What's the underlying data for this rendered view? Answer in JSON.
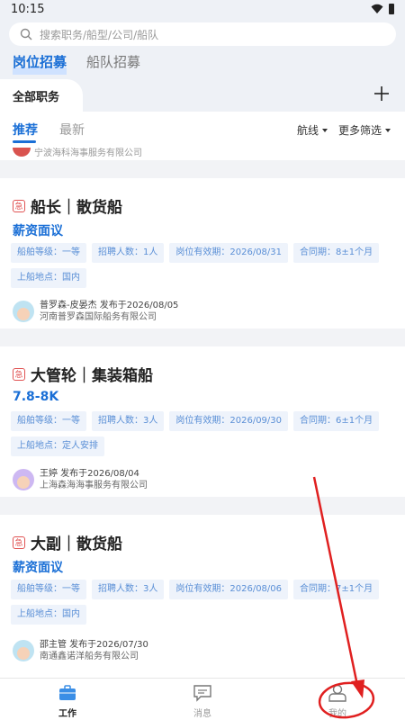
{
  "status_bar": {
    "time": "10:15"
  },
  "search": {
    "placeholder": "搜索职务/船型/公司/船队"
  },
  "top_tabs": [
    {
      "label": "岗位招募"
    },
    {
      "label": "船队招募"
    }
  ],
  "category": {
    "label": "全部职务"
  },
  "sub_tabs": [
    {
      "label": "推荐"
    },
    {
      "label": "最新"
    }
  ],
  "filters": [
    {
      "label": "航线"
    },
    {
      "label": "更多筛选"
    }
  ],
  "partial_card": {
    "company": "宁波海科海事服务有限公司"
  },
  "urgent_label": "急",
  "cards": [
    {
      "title": "船长｜散货船",
      "salary": "薪资面议",
      "tags": [
        "船舶等级：一等",
        "招聘人数：1人",
        "岗位有效期：2026/08/31",
        "合同期：8±1个月",
        "上船地点：国内"
      ],
      "poster": "普罗森-皮晏杰 发布于2026/08/05",
      "company": "河南普罗森国际船务有限公司"
    },
    {
      "title": "大管轮｜集装箱船",
      "salary": "7.8-8K",
      "tags": [
        "船舶等级：一等",
        "招聘人数：3人",
        "岗位有效期：2026/09/30",
        "合同期：6±1个月",
        "上船地点：定人安排"
      ],
      "poster": "王婷 发布于2026/08/04",
      "company": "上海森海海事服务有限公司"
    },
    {
      "title": "大副｜散货船",
      "salary": "薪资面议",
      "tags": [
        "船舶等级：一等",
        "招聘人数：3人",
        "岗位有效期：2026/08/06",
        "合同期：7±1个月",
        "上船地点：国内"
      ],
      "poster": "邵主管 发布于2026/07/30",
      "company": "南通鑫诺洋船务有限公司"
    }
  ],
  "bottom_nav": [
    {
      "label": "工作",
      "icon": "briefcase-icon"
    },
    {
      "label": "消息",
      "icon": "message-icon"
    },
    {
      "label": "我的",
      "icon": "profile-icon"
    }
  ],
  "colors": {
    "accent": "#1a6fd6",
    "annotation": "#e02020",
    "urgent": "#e05353"
  }
}
